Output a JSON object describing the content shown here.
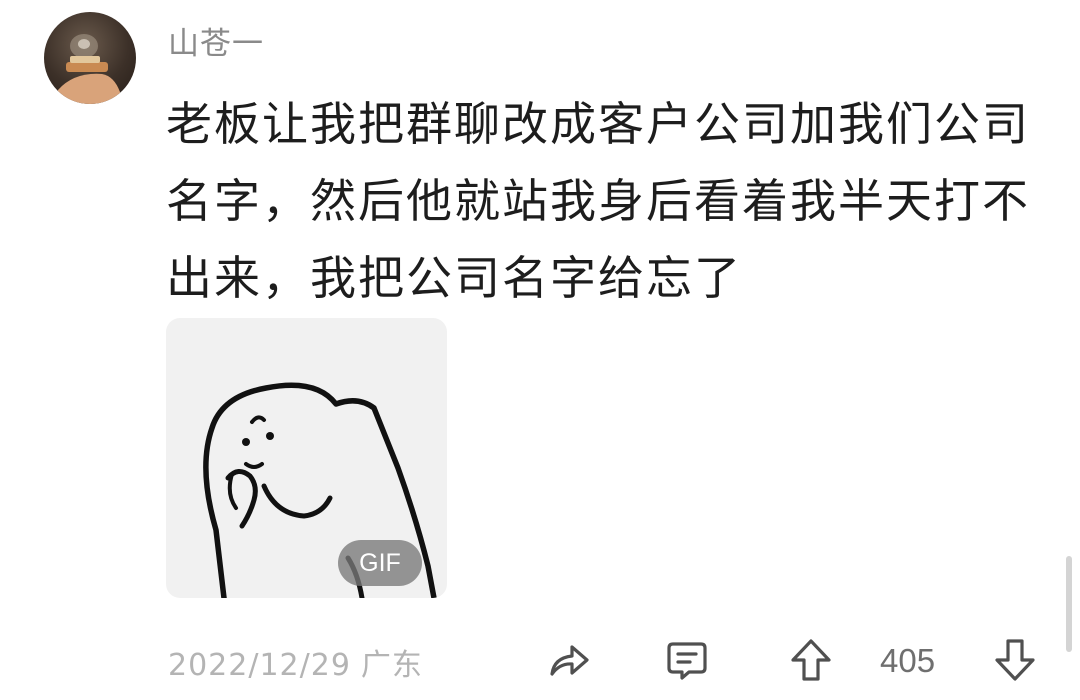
{
  "comment": {
    "username": "山苍一",
    "text": "老板让我把群聊改成客户公司加我们公司名字，然后他就站我身后看着我半天打不出来，我把公司名字给忘了",
    "gif_badge": "GIF",
    "date": "2022/12/29",
    "location": "广东",
    "vote_count": "405"
  },
  "icons": {
    "share": "share-arrow-icon",
    "reply": "comment-bubble-icon",
    "upvote": "arrow-up-icon",
    "downvote": "arrow-down-icon"
  },
  "colors": {
    "text_primary": "#1d1d1d",
    "text_secondary": "#8a8a8a",
    "meta": "#b4b4b4",
    "icon": "#505050"
  }
}
